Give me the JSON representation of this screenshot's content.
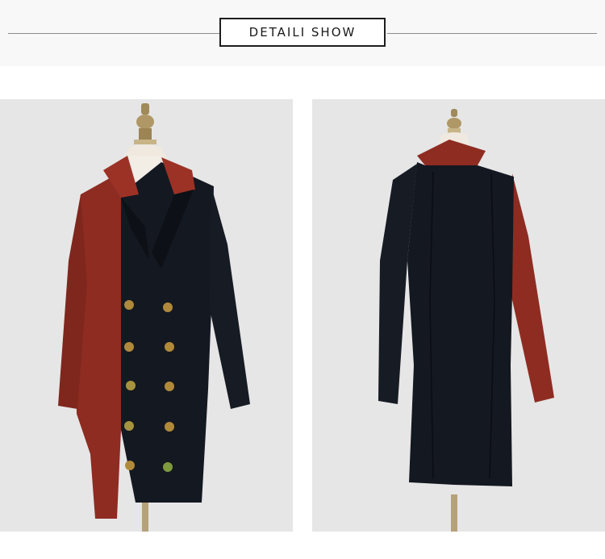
{
  "header": {
    "title": "DETAILI SHOW"
  },
  "colors": {
    "background": "#ffffff",
    "panel": "#e6e6e6",
    "rule": "#8a8a8a",
    "coat_black": "#141821",
    "coat_red": "#8e2c22",
    "button_gold": "#b08a3a"
  },
  "photos": [
    {
      "view": "front",
      "icon": "mannequin-front"
    },
    {
      "view": "back",
      "icon": "mannequin-back"
    }
  ]
}
